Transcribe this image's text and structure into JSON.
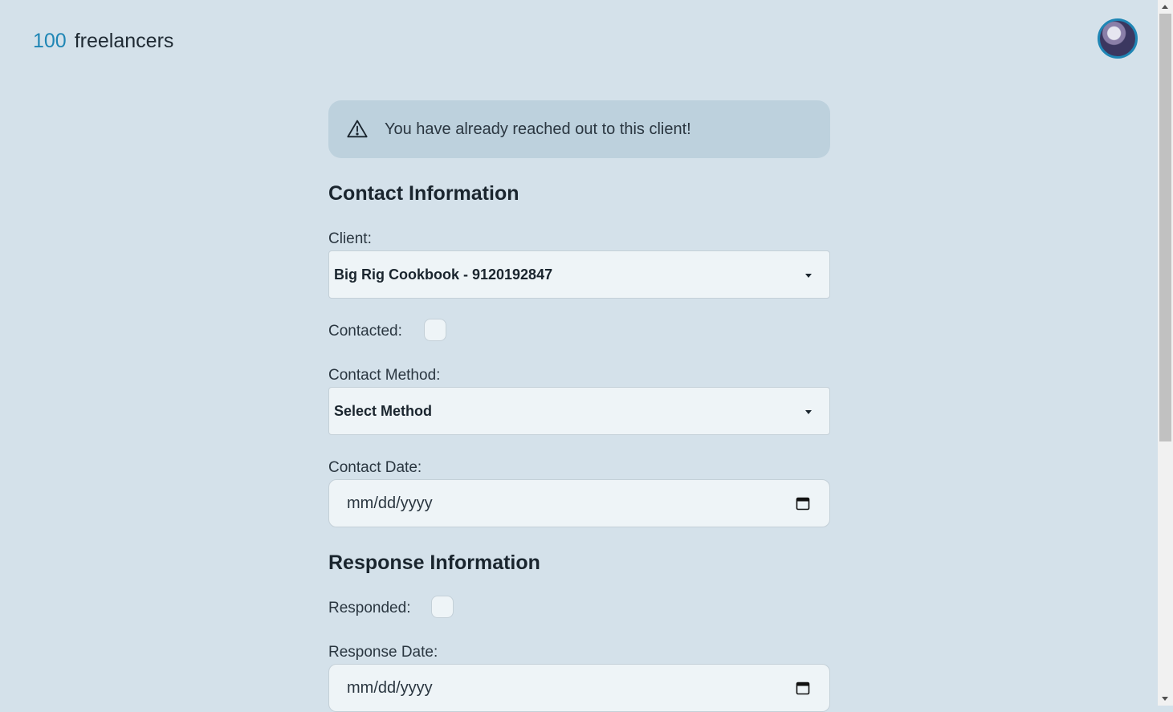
{
  "header": {
    "logo_number": "100",
    "logo_text": "freelancers",
    "avatar_icon": "user-avatar"
  },
  "alert": {
    "icon": "warning-icon",
    "message": "You have already reached out to this client!"
  },
  "contact_section": {
    "title": "Contact Information",
    "client_label": "Client:",
    "client_value": "Big Rig Cookbook - 9120192847",
    "contacted_label": "Contacted:",
    "contacted_checked": false,
    "method_label": "Contact Method:",
    "method_value": "Select Method",
    "date_label": "Contact Date:",
    "date_placeholder": "mm/dd/yyyy"
  },
  "response_section": {
    "title": "Response Information",
    "responded_label": "Responded:",
    "responded_checked": false,
    "date_label": "Response Date:",
    "date_placeholder": "mm/dd/yyyy"
  },
  "colors": {
    "background": "#d4e1ea",
    "accent": "#1f86b5",
    "alert_bg": "#bdd1dd"
  }
}
